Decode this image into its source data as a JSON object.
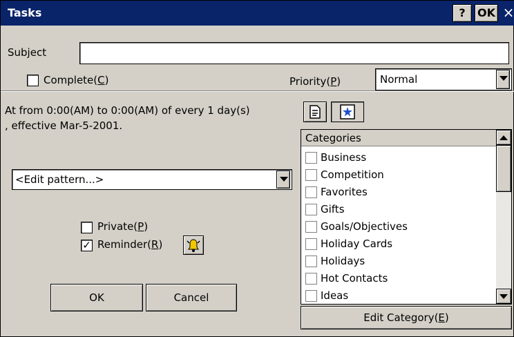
{
  "window": {
    "title": "Tasks",
    "help_label": "?",
    "ok_label": "OK",
    "close_label": "×"
  },
  "subject": {
    "label": "Subject",
    "value": ""
  },
  "complete": {
    "label": "Complete(",
    "key": "C",
    "suffix": ")",
    "checked": false
  },
  "priority": {
    "label": "Priority(",
    "key": "P",
    "suffix": ")",
    "value": "Normal"
  },
  "recurrence": {
    "line1": "At from 0:00(AM) to 0:00(AM) of every 1 day(s)",
    "line2": ", effective Mar-5-2001.",
    "pattern": "<Edit pattern...>"
  },
  "private": {
    "label": "Private(",
    "key": "P",
    "suffix": ")",
    "checked": false
  },
  "reminder": {
    "label": "Reminder(",
    "key": "R",
    "suffix": ")",
    "checked": true,
    "check_mark": "✓"
  },
  "buttons": {
    "ok": "OK",
    "cancel": "Cancel"
  },
  "categories": {
    "header": "Categories",
    "items": [
      "Business",
      "Competition",
      "Favorites",
      "Gifts",
      "Goals/Objectives",
      "Holiday Cards",
      "Holidays",
      "Hot Contacts",
      "Ideas"
    ],
    "edit_label": "Edit Category(",
    "edit_key": "E",
    "edit_suffix": ")"
  },
  "icons": {
    "notes_tab": "notes-icon",
    "categories_tab": "category-icon",
    "alarm": "bell-icon"
  },
  "colors": {
    "titlebar": "#0a246a",
    "face": "#d4d0c8"
  }
}
